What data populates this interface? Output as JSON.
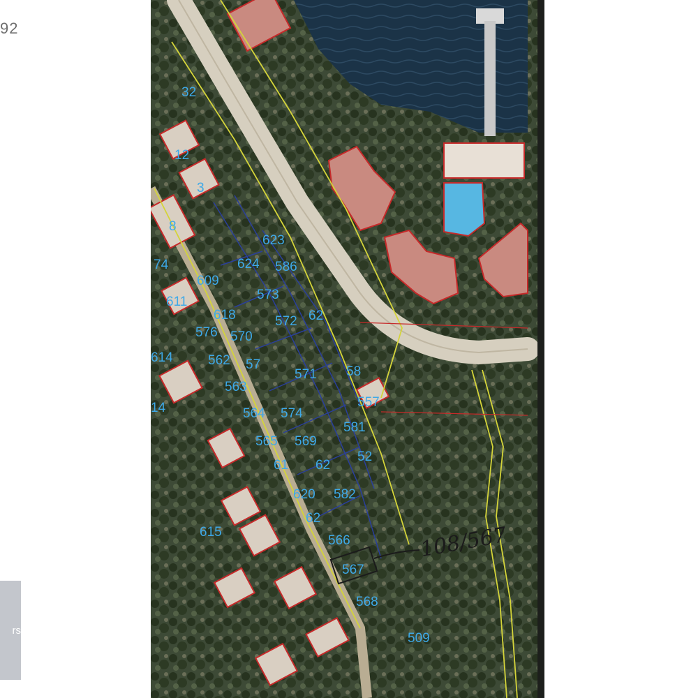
{
  "page": {
    "id_fragment": "92",
    "side_button_label": "rs"
  },
  "map": {
    "type": "cadastral parcel map on aerial photo",
    "colors": {
      "sea": "#1b3347",
      "pool": "#57b7e2",
      "parcel_text": "#3ea9e8",
      "parcel_line": "#2a3f9c",
      "building_outline": "#c62a2a",
      "boundary_line": "#d4d43a",
      "handwriting": "#1b1b1b"
    },
    "handwritten_note": "108/567",
    "parcel_labels": [
      "32",
      "12",
      "3",
      "8",
      "74",
      "614",
      "611",
      "609",
      "623",
      "624",
      "586",
      "573",
      "618",
      "62",
      "572",
      "576",
      "570",
      "562",
      "57",
      "563",
      "58",
      "571",
      "557",
      "564",
      "574",
      "581",
      "565",
      "569",
      "61",
      "62",
      "620",
      "62",
      "52",
      "582",
      "615",
      "566",
      "567",
      "568",
      "509",
      "14"
    ]
  }
}
